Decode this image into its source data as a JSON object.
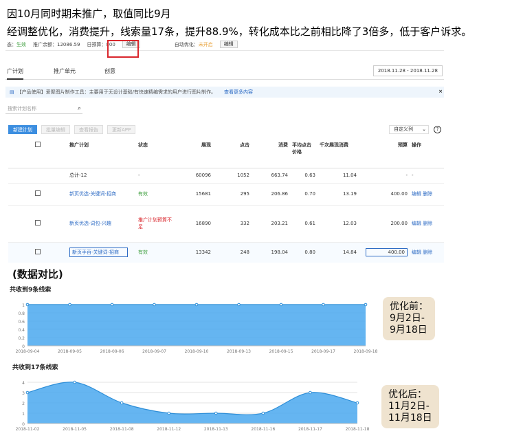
{
  "headline": {
    "line1": "因10月同时期未推广，取值同比9月",
    "line2": "经调整优化，消费提升，线索量17条，提升88.9%，转化成本比之前相比降了3倍多，低于客户诉求。"
  },
  "topbar": {
    "status_label": "态：",
    "status_value": "生效",
    "balance": "推广余额：12086.59",
    "budget": "日预算：800",
    "edit1": "编辑",
    "auto_opt_label": "自动优化：",
    "auto_opt_value": "未开启",
    "edit2": "编辑"
  },
  "tabs": [
    "广计划",
    "推广单元",
    "创意"
  ],
  "date_range": "2018.11.28 - 2018.11.28",
  "notice": {
    "text": "【产品使用】爱聚图片制作工具：主要用于无设计基础/有快速精编需求的用户进行图片制作。",
    "link": "查看更多内容",
    "close": "×"
  },
  "search": {
    "placeholder": "搜索计划名称",
    "icon": "search-icon"
  },
  "actions": [
    "新建计划",
    "批量编辑",
    "查看报告",
    "更新APP"
  ],
  "custom_columns": "自定义列",
  "table": {
    "headers": [
      "推广计划",
      "状态",
      "展现",
      "点击",
      "消费",
      "平均点击价格",
      "千次展现消费",
      "预算",
      "操作"
    ],
    "total": {
      "name": "总计-12",
      "status": "-",
      "impr": "60096",
      "clicks": "1052",
      "cost": "663.74",
      "cpc": "0.63",
      "cpm": "11.04",
      "budget": "-",
      "ops": "-"
    },
    "rows": [
      {
        "name": "新页优选-关键词-招商",
        "status": "有效",
        "impr": "15681",
        "clicks": "295",
        "cost": "206.86",
        "cpc": "0.70",
        "cpm": "13.19",
        "budget": "400.00",
        "op1": "编辑",
        "op2": "删除"
      },
      {
        "name": "新页优选-词包-兴趣",
        "status": "推广计划预算不足",
        "impr": "16890",
        "clicks": "332",
        "cost": "203.21",
        "cpc": "0.61",
        "cpm": "12.03",
        "budget": "200.00",
        "op1": "编辑",
        "op2": "删除"
      },
      {
        "name": "新页手百-关键词-招商",
        "status": "有效",
        "impr": "13342",
        "clicks": "248",
        "cost": "198.04",
        "cpc": "0.80",
        "cpm": "14.84",
        "budget": "400.00",
        "op1": "编辑",
        "op2": "删除"
      }
    ]
  },
  "section_title": "(数据对比)",
  "charts": [
    {
      "title": "共收到9条线索",
      "badge": [
        "优化前：",
        "9月2日-",
        "9月18日"
      ],
      "accent": "#4aa8ef",
      "chart_data": {
        "type": "area",
        "x": [
          "2018-09-04",
          "2018-09-05",
          "2018-09-06",
          "2018-09-07",
          "2018-09-10",
          "2018-09-13",
          "2018-09-15",
          "2018-09-17",
          "2018-09-18"
        ],
        "values": [
          1,
          1,
          1,
          1,
          1,
          1,
          1,
          1,
          1
        ],
        "yticks": [
          "0",
          "0.2",
          "0.4",
          "0.6",
          "0.8",
          "1"
        ],
        "ylim": [
          0,
          1
        ]
      }
    },
    {
      "title": "共收到17条线索",
      "badge": [
        "优化后：",
        "11月2日-",
        "11月18日"
      ],
      "accent": "#4aa8ef",
      "chart_data": {
        "type": "area",
        "x": [
          "2018-11-02",
          "2018-11-05",
          "2018-11-08",
          "2018-11-12",
          "2018-11-13",
          "2018-11-16",
          "2018-11-17",
          "2018-11-18"
        ],
        "values": [
          3,
          4,
          2,
          1,
          1,
          1,
          3,
          2
        ],
        "yticks": [
          "0",
          "1",
          "2",
          "3",
          "4"
        ],
        "ylim": [
          0,
          4
        ]
      }
    }
  ]
}
